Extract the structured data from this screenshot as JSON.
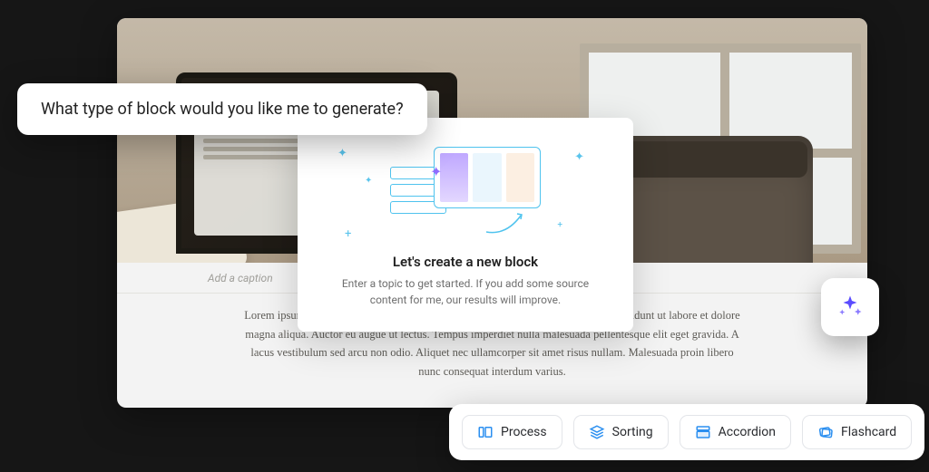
{
  "editor": {
    "caption_placeholder": "Add a caption",
    "body": "Lorem ipsum dolor sit amet, consectetur adipiscing elit, sed do eiusmod tempor incididunt ut labore et dolore magna aliqua. Auctor eu augue ut lectus. Tempus imperdiet nulla malesuada pellentesque elit eget gravida. A lacus vestibulum sed arcu non odio. Aliquet nec ullamcorper sit amet risus nullam. Malesuada proin libero nunc consequat interdum varius."
  },
  "modal": {
    "title": "Let's create a new block",
    "subtitle": "Enter a topic to get started. If you add some source content for me, our results will improve."
  },
  "prompt": {
    "question": "What type of block would you like me to generate?"
  },
  "options": {
    "process": "Process",
    "sorting": "Sorting",
    "accordion": "Accordion",
    "flashcard": "Flashcard"
  }
}
